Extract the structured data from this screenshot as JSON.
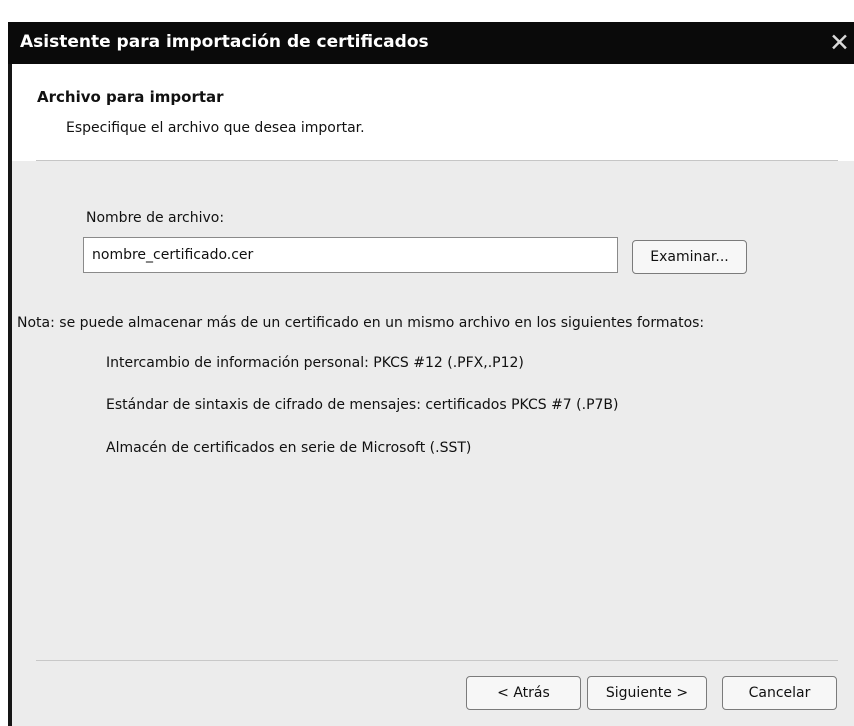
{
  "window": {
    "title": "Asistente para importación de certificados",
    "close_glyph": "✕"
  },
  "header": {
    "title": "Archivo para importar",
    "subtitle": "Especifique el archivo que desea importar."
  },
  "file": {
    "label": "Nombre de archivo:",
    "value": "nombre_certificado.cer",
    "browse_label": "Examinar..."
  },
  "note": {
    "text": "Nota: se puede almacenar más de un certificado en un mismo archivo en los siguientes formatos:",
    "formats": [
      "Intercambio de información personal: PKCS #12 (.PFX,.P12)",
      "Estándar de sintaxis de cifrado de mensajes: certificados PKCS #7 (.P7B)",
      "Almacén de certificados en serie de Microsoft (.SST)"
    ]
  },
  "buttons": {
    "back": "< Atrás",
    "next": "Siguiente >",
    "cancel": "Cancelar"
  }
}
